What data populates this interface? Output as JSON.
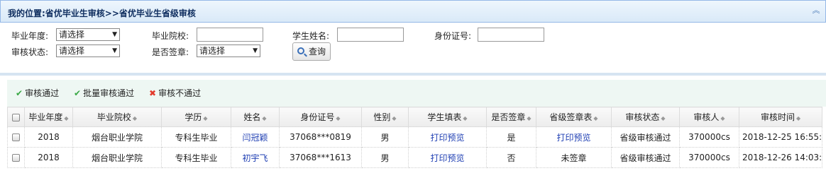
{
  "header": {
    "title": "我的位置:省优毕业生审核>>省优毕业生省级审核"
  },
  "search": {
    "year_label": "毕业年度:",
    "year_value": "请选择",
    "school_label": "毕业院校:",
    "school_value": "",
    "name_label": "学生姓名:",
    "name_value": "",
    "id_label": "身份证号:",
    "id_value": "",
    "status_label": "审核状态:",
    "status_value": "请选择",
    "signed_label": "是否签章:",
    "signed_value": "请选择",
    "query_label": "查询"
  },
  "toolbar": {
    "approve": "审核通过",
    "batch_approve": "批量审核通过",
    "reject": "审核不通过"
  },
  "table": {
    "columns": [
      "毕业年度",
      "毕业院校",
      "学历",
      "姓名",
      "身份证号",
      "性别",
      "学生填表",
      "是否签章",
      "省级签章表",
      "审核状态",
      "审核人",
      "审核时间"
    ],
    "rows": [
      [
        "2018",
        "烟台职业学院",
        "专科生毕业",
        "闫冠颖",
        "37068***0819",
        "男",
        "打印预览",
        "是",
        "打印预览",
        "省级审核通过",
        "370000cs",
        "2018-12-25 16:55:"
      ],
      [
        "2018",
        "烟台职业学院",
        "专科生毕业",
        "初宇飞",
        "37068***1613",
        "男",
        "打印预览",
        "否",
        "未签章",
        "省级审核通过",
        "370000cs",
        "2018-12-26 14:03:"
      ]
    ]
  },
  "colors": {
    "header_bg": "#d9e9f8",
    "link": "#1f3fb3",
    "approve_icon": "#39a845",
    "reject_icon": "#e23a2c"
  }
}
